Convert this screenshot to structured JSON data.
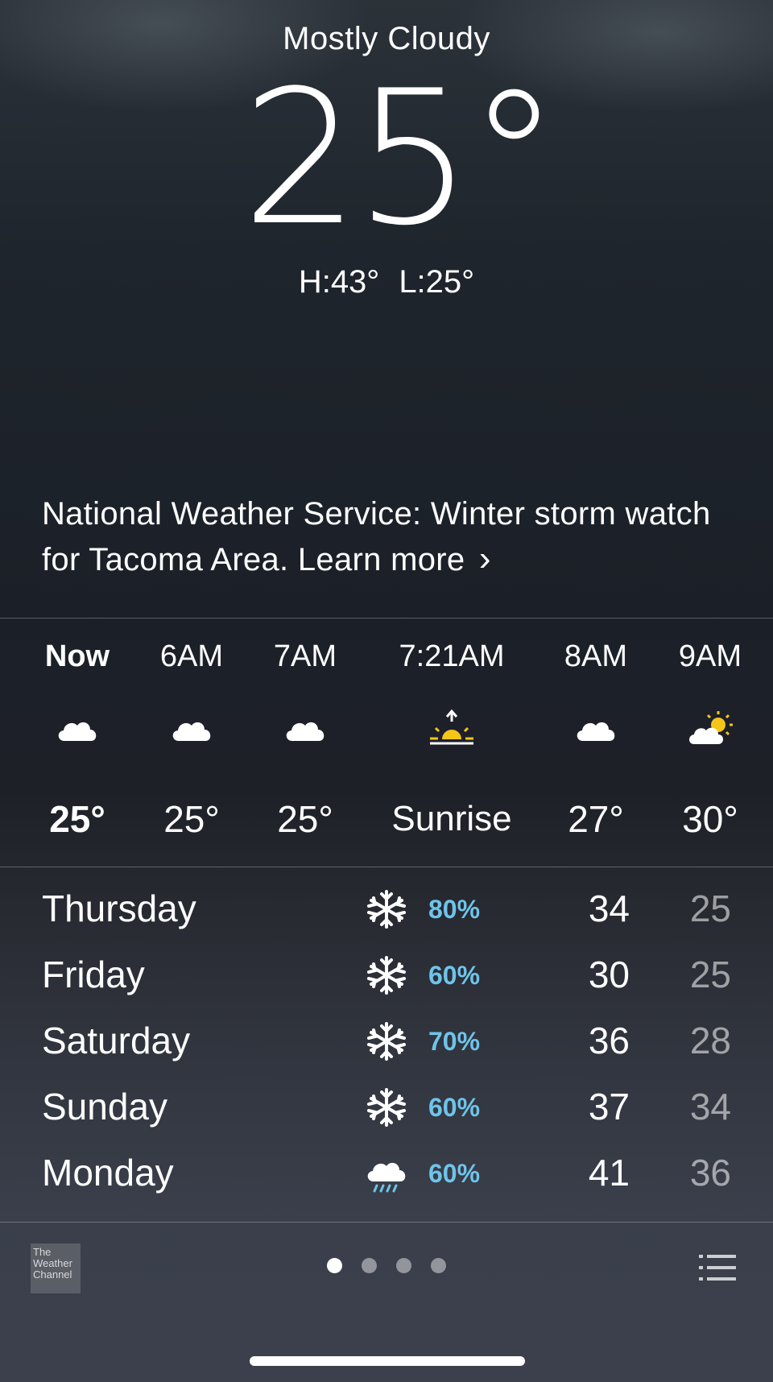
{
  "current": {
    "condition": "Mostly Cloudy",
    "temperature": "25°",
    "high": "H:43°",
    "low": "L:25°"
  },
  "alert": {
    "text": "National Weather Service: Winter storm watch for Tacoma Area. Learn more",
    "chevron": "›"
  },
  "hourly": [
    {
      "time": "Now",
      "icon": "cloud-icon",
      "temp": "25°"
    },
    {
      "time": "6AM",
      "icon": "cloud-icon",
      "temp": "25°"
    },
    {
      "time": "7AM",
      "icon": "cloud-icon",
      "temp": "25°"
    },
    {
      "time": "7:21AM",
      "icon": "sunrise-icon",
      "temp": "Sunrise"
    },
    {
      "time": "8AM",
      "icon": "cloud-icon",
      "temp": "27°"
    },
    {
      "time": "9AM",
      "icon": "partly-sunny-icon",
      "temp": "30°"
    }
  ],
  "daily": [
    {
      "day": "Thursday",
      "icon": "snowflake-icon",
      "chance": "80%",
      "high": "34",
      "low": "25"
    },
    {
      "day": "Friday",
      "icon": "snowflake-icon",
      "chance": "60%",
      "high": "30",
      "low": "25"
    },
    {
      "day": "Saturday",
      "icon": "snowflake-icon",
      "chance": "70%",
      "high": "36",
      "low": "28"
    },
    {
      "day": "Sunday",
      "icon": "snowflake-icon",
      "chance": "60%",
      "high": "37",
      "low": "34"
    },
    {
      "day": "Monday",
      "icon": "rain-cloud-icon",
      "chance": "60%",
      "high": "41",
      "low": "36"
    }
  ],
  "footer": {
    "logo_text": "The Weather Channel",
    "page_count": 4,
    "active_page": 1
  },
  "colors": {
    "precip_chance": "#6fc4ea",
    "sun": "#f5c518"
  }
}
